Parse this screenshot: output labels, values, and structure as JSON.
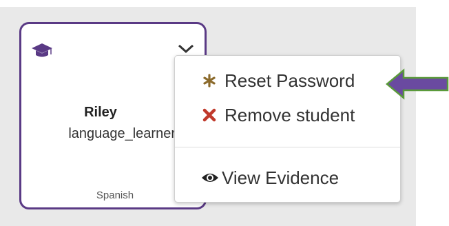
{
  "card": {
    "name": "Riley",
    "username": "language_learner",
    "language": "Spanish",
    "icon": "graduation-cap-icon"
  },
  "menu": {
    "items": [
      {
        "label": "Reset Password",
        "icon": "asterisk-icon",
        "color": "#8b6a2b"
      },
      {
        "label": "Remove student",
        "icon": "x-icon",
        "color": "#c0392b"
      },
      {
        "label": "View Evidence",
        "icon": "eye-icon",
        "color": "#222222"
      }
    ]
  },
  "colors": {
    "accent": "#5a3a85",
    "arrow": "#6a4aa0",
    "panel_bg": "#e9e9e9"
  }
}
